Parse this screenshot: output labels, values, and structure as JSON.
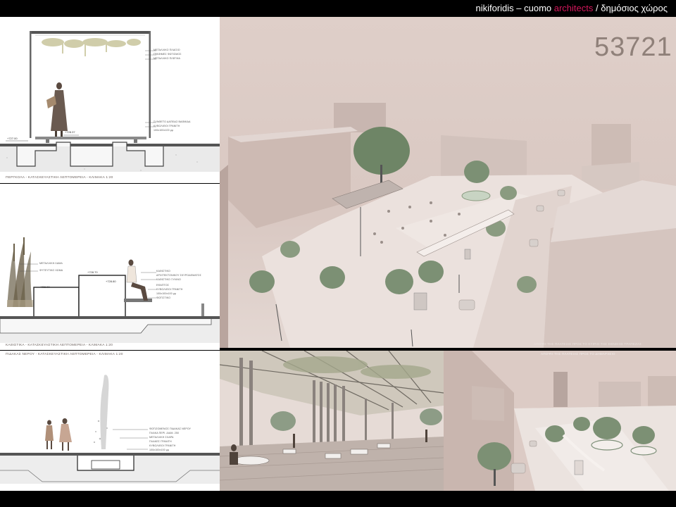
{
  "header": {
    "prefix": "nikiforidis – cuomo",
    "accent": "architects",
    "separator": "/",
    "subtitle": "δημόσιος χώρος"
  },
  "project_number": "53721",
  "colors": {
    "accent": "#d4175c",
    "sky": "#dccbc5",
    "frame": "#000000"
  },
  "sections": {
    "pergola": {
      "caption": "ΠΕΡΓΚΟΛΑ - ΚΑΤΑΣΚΕΥΑΣΤΙΚΗ ΛΕΠΤΟΜΕΡΕΙΑ - ΚΛΙΜΑΚΑ 1:20",
      "notes": [
        "ΜΕΤΑΛΛΙΚΟ ΠΛΑΙΣΙΟ",
        "ΓΡΑΦΙΜΕΣ ΦΩΤΙΣΜΟΣ",
        "ΜΕΤΑΛΛΙΚΟ ΠΛΕΓΜΑ"
      ],
      "notes_low": [
        "ΣΥΝΘΕΤΟ ΔΑΠΕΔΟ ΒΑΘΜΙΔΑ",
        "ΚΥΒΟΛΙΘΟΙ ΓΡΑΝΙΤΗ",
        "100x100x100 μμ"
      ],
      "levels": [
        "+728.37",
        "+727.00"
      ]
    },
    "seating": {
      "caption": "ΚΑΘΙΣΤΙΚΑ - ΚΑΤΑΣΚΕΥΑΣΤΙΚΗ ΛΕΠΤΟΜΕΡΕΙΑ - ΚΛΙΜΑΚΑ 1:20",
      "notes_left": [
        "ΜΕΤΑΛΛΙΚΗ ΛΑΜΑ",
        "ΦΥΤΕΥΤΙΚΟ ΧΩΜΑ"
      ],
      "notes_right": [
        "ΚΑΘΙΣΤΙΚΟ",
        "ΑΡΧΙΤΕΚΤΟΝΙΚΟΥ ΣΚΥΡΟΔΕΜΑΤΟΣ",
        "ΚΑΘΙΣΤΙΚΟ ΞΥΛΙΝΟ",
        "ΕΦΑΠΤΟΣ",
        "ΚΥΒΟΛΙΘΟΙ ΓΡΑΝΙΤΗ",
        "100x100x100 μμ",
        "ΦΩΤΙΣΤΙΚΟ"
      ],
      "levels": [
        "+728.70",
        "+728.00",
        "+728.80"
      ]
    },
    "fountain": {
      "caption": "ΠΙΔΑΚΑΣ ΝΕΡΟΥ - ΚΑΤΑΣΚΕΥΑΣΤΙΚΗ ΛΕΠΤΟΜΕΡΕΙΑ - ΚΛΙΜΑΚΑ 1:20",
      "notes": [
        "ΦΩΤΙΖΟΜΕΝΟΣ ΠΙΔΑΚΑΣ ΝΕΡΟΥ",
        "ΠΛΑΚΑ ΠΕΡΙ. ΔΙΑΜ. 250",
        "ΜΕΤΑΛΛΙΚΗ ΣΧΑΡΑ",
        "ΠΛΑΚΕΣ ΓΡΑΝΙΤΗ",
        "ΚΥΒΟΛΙΘΟΙ ΓΡΑΝΙΤΗ",
        "100x100x100 μμ"
      ]
    }
  },
  "views": {
    "aerial_caption": "ΑΠΟΨΗ ΤΗΣ ΠΛΑΤΕΙΑΣ ΠΡΟΣ ΤΟ ΚΤΙΡΙΟ ΤΗΣ ΕΘΝΙΚΗΣ ΤΡΑΠΕΖΑΣ",
    "street_caption": "ΑΠΟΨΗ ΤΗΣ ΠΛΑΤΕΙΑΣ ΠΡΟΣ ΤΟ ΔΗΜΑΡΧΕΙΟ"
  }
}
